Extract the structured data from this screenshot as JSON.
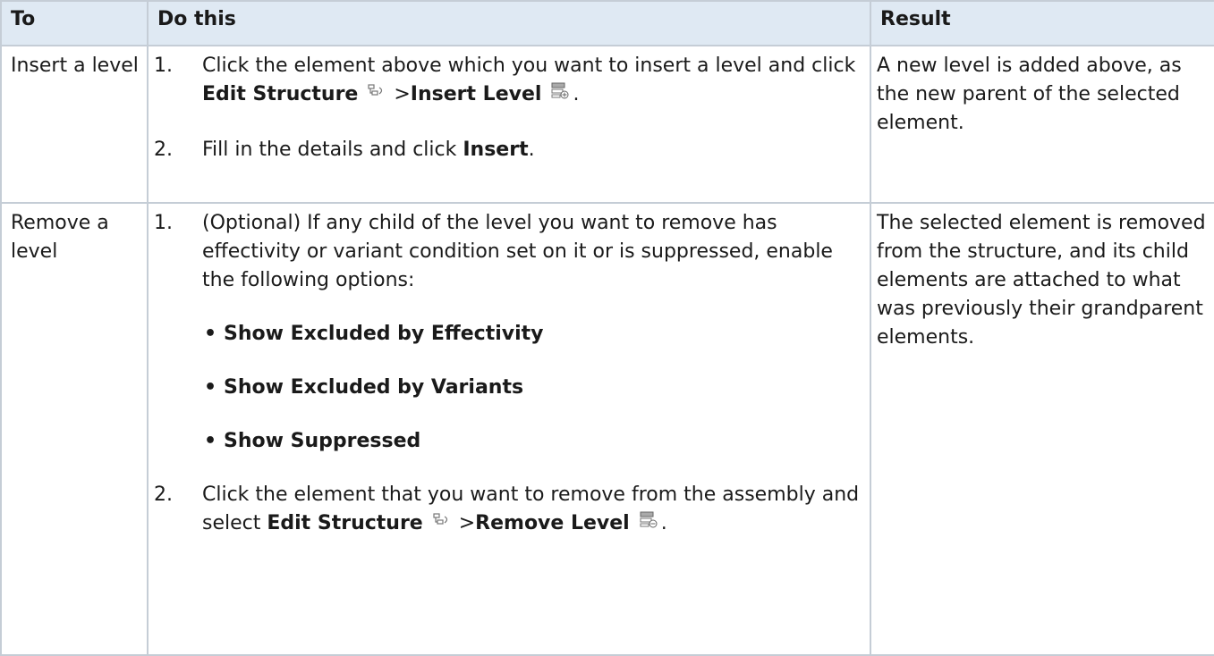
{
  "table": {
    "headers": {
      "to": "To",
      "do": "Do this",
      "result": "Result"
    },
    "rows": [
      {
        "to": "Insert a level",
        "steps": [
          {
            "num": "1.",
            "text_a": "Click the element above which you want to insert a level and click ",
            "b1": "Edit Structure",
            "sep": " >",
            "b2": "Insert Level",
            "end": "."
          },
          {
            "num": "2.",
            "text_a": "Fill in the details and click ",
            "b1": "Insert",
            "end": "."
          }
        ],
        "result": "A new level is added above, as the new parent of the selected element."
      },
      {
        "to": "Remove a level",
        "steps": [
          {
            "num": "1.",
            "text_a": "(Optional) If any child of the level you want to remove has effectivity or variant condition set on it or is suppressed, enable the following options:",
            "options": [
              "Show Excluded by Effectivity",
              "Show Excluded by Variants",
              "Show Suppressed"
            ]
          },
          {
            "num": "2.",
            "text_a": "Click the element that you want to remove from the assembly and select ",
            "b1": "Edit Structure",
            "sep": " >",
            "b2": "Remove Level",
            "end": "."
          }
        ],
        "result": "The selected element is removed from the structure, and its child elements are attached to what was previously their grandparent elements."
      }
    ]
  },
  "icons": [
    "edit-structure-icon",
    "insert-level-icon",
    "remove-level-icon"
  ]
}
